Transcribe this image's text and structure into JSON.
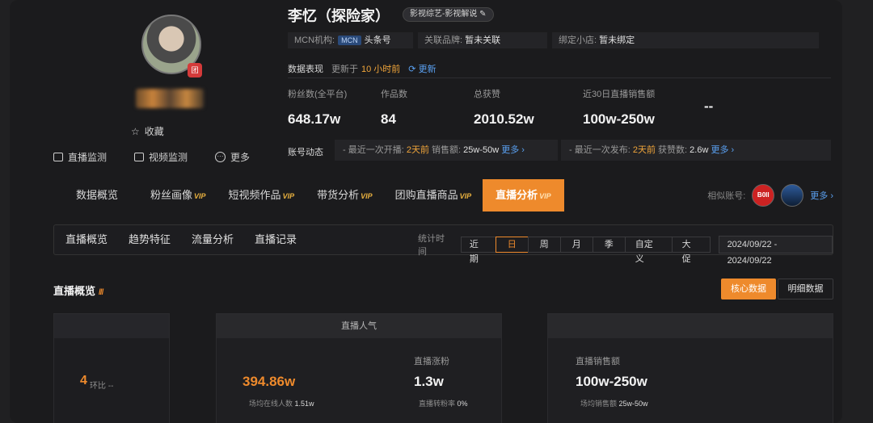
{
  "profile": {
    "name": "李忆（探险家）",
    "category_tag": "影视综艺-影视解说 ✎",
    "avatar_badge": "团",
    "favorite_label": "收藏",
    "left_links": [
      "直播监测",
      "视频监测",
      "更多"
    ],
    "info": {
      "mcn_label": "MCN机构:",
      "mcn_chip": "MCN",
      "mcn_value": "头条号",
      "brand_label": "关联品牌:",
      "brand_value": "暂未关联",
      "shop_label": "绑定小店:",
      "shop_value": "暂未绑定"
    }
  },
  "data_header": {
    "title": "数据表现",
    "updated_prefix": "更新于",
    "updated_value": "10 小时前",
    "refresh": "⟳ 更新"
  },
  "stats": [
    {
      "label": "粉丝数(全平台)",
      "value": "648.17w"
    },
    {
      "label": "作品数",
      "value": "84"
    },
    {
      "label": "总获赞",
      "value": "2010.52w"
    },
    {
      "label": "近30日直播销售额",
      "value": "100w-250w"
    },
    {
      "label": "",
      "value": "--"
    }
  ],
  "account_activity": {
    "label": "账号动态",
    "live": {
      "prefix": "- 最近一次开播:",
      "time": "2天前",
      "sales_label": "销售额:",
      "sales": "25w-50w",
      "more": "更多 ›"
    },
    "post": {
      "prefix": "- 最近一次发布:",
      "time": "2天前",
      "likes_label": "获赞数:",
      "likes": "2.6w",
      "more": "更多 ›"
    }
  },
  "tabs": [
    {
      "label": "数据概览",
      "vip": ""
    },
    {
      "label": "粉丝画像",
      "vip": "VIP"
    },
    {
      "label": "短视频作品",
      "vip": "VIP"
    },
    {
      "label": "带货分析",
      "vip": "VIP"
    },
    {
      "label": "团购直播商品",
      "vip": "VIP"
    },
    {
      "label": "直播分析",
      "vip": "VIP"
    }
  ],
  "similar": {
    "label": "相似账号:",
    "more": "更多 ›",
    "logo_text": "B0II"
  },
  "subtabs": [
    "直播概览",
    "趋势特征",
    "流量分析",
    "直播记录"
  ],
  "period": {
    "label": "统计时间",
    "options": [
      "近期",
      "日",
      "周",
      "月",
      "季",
      "自定义",
      "大促"
    ],
    "selected": "日",
    "range": "2024/09/22 - 2024/09/22"
  },
  "overview": {
    "title": "直播概览",
    "bars": "///",
    "core_btn": "核心数据",
    "detail_btn": "明细数据"
  },
  "cards": {
    "left": {
      "value": "4",
      "sub": "环比 --"
    },
    "popularity": {
      "head": "直播人气",
      "main_value": "394.86w",
      "main_sub_label": "场均在线人数",
      "main_sub_value": "1.51w",
      "fans_label": "直播涨粉",
      "fans_value": "1.3w",
      "fans_sub_label": "直播转粉率",
      "fans_sub_value": "0%"
    },
    "sales": {
      "label": "直播销售额",
      "value": "100w-250w",
      "sub_label": "场均销售额",
      "sub_value": "25w-50w"
    }
  },
  "colors": {
    "accent": "#ee8a2c",
    "link": "#5aa0f0",
    "vip": "#e9b13f"
  }
}
